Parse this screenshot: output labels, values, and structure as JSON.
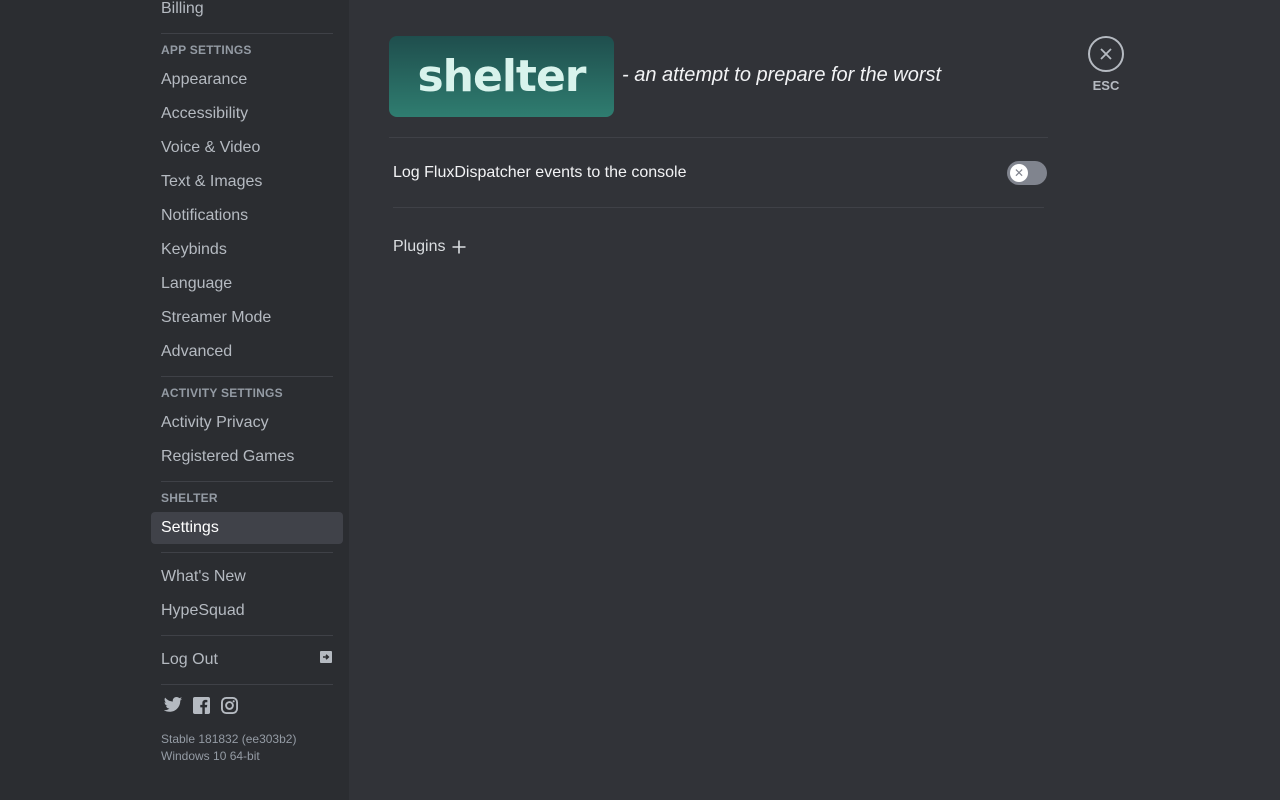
{
  "sidebar": {
    "top_item": "Billing",
    "app_settings": {
      "header": "App Settings",
      "items": [
        "Appearance",
        "Accessibility",
        "Voice & Video",
        "Text & Images",
        "Notifications",
        "Keybinds",
        "Language",
        "Streamer Mode",
        "Advanced"
      ]
    },
    "activity_settings": {
      "header": "Activity Settings",
      "items": [
        "Activity Privacy",
        "Registered Games"
      ]
    },
    "shelter": {
      "header": "Shelter",
      "items": [
        "Settings"
      ],
      "selected": "Settings"
    },
    "misc_items": [
      "What's New",
      "HypeSquad"
    ],
    "logout_label": "Log Out",
    "social_icons": [
      "twitter-icon",
      "facebook-icon",
      "instagram-icon"
    ],
    "version": {
      "build": "Stable 181832 (ee303b2)",
      "os": "Windows 10 64-bit"
    }
  },
  "main": {
    "logo_text": "shelter",
    "tagline": "- an attempt to prepare for the worst",
    "settings": [
      {
        "label": "Log FluxDispatcher events to the console",
        "enabled": false
      }
    ],
    "plugins_label": "Plugins"
  },
  "close": {
    "esc_label": "ESC"
  },
  "colors": {
    "sidebar_bg": "#2b2d31",
    "content_bg": "#313338",
    "selected_bg": "#404249",
    "logo_gradient_top": "#1f4e4d",
    "logo_gradient_bottom": "#2f7d70",
    "toggle_off": "#80848e"
  }
}
